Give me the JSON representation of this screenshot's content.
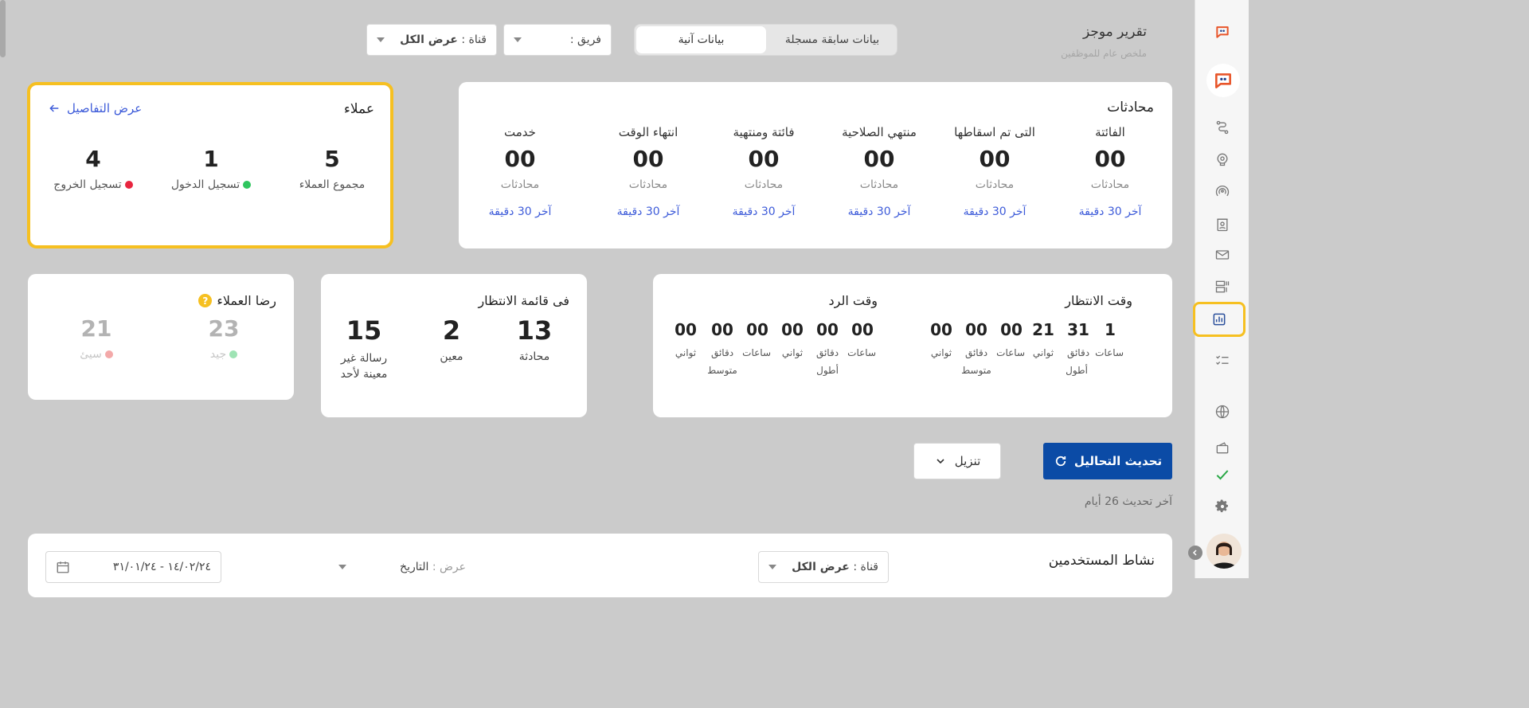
{
  "header": {
    "title": "تقرير موجز",
    "subtitle": "ملخص عام للموظفين",
    "mode_tabs": {
      "active": "بيانات آنية",
      "inactive": "بيانات سابقة مسجلة"
    },
    "team_filter": {
      "label": "فريق :",
      "value": ""
    },
    "channel_filter": {
      "label": "قناة :",
      "value": "عرض الكل"
    }
  },
  "chats_card": {
    "title": "محادثات",
    "columns": [
      {
        "label": "الفائتة",
        "value": "00",
        "unit": "محادثات",
        "link": "آخر 30 دقيقة"
      },
      {
        "label": "التى تم اسقاطها",
        "value": "00",
        "unit": "محادثات",
        "link": "آخر 30 دقيقة"
      },
      {
        "label": "منتهي الصلاحية",
        "value": "00",
        "unit": "محادثات",
        "link": "آخر 30 دقيقة"
      },
      {
        "label": "فائتة ومنتهية",
        "value": "00",
        "unit": "محادثات",
        "link": "آخر 30 دقيقة"
      },
      {
        "label": "انتهاء الوقت",
        "value": "00",
        "unit": "محادثات",
        "link": "آخر 30 دقيقة"
      },
      {
        "label": "خدمت",
        "value": "00",
        "unit": "محادثات",
        "link": "آخر 30 دقيقة"
      }
    ]
  },
  "agents_card": {
    "title": "عملاء",
    "details_link": "عرض التفاصيل",
    "total": {
      "label": "مجموع العملاء",
      "value": "5"
    },
    "logged_in": {
      "label": "تسجيل الدخول",
      "value": "1",
      "color": "#2fc55e"
    },
    "logged_out": {
      "label": "تسجيل الخروج",
      "value": "4",
      "color": "#e8253f"
    }
  },
  "time_card": {
    "wait": {
      "title": "وقت الانتظار",
      "longest_label": "أطول",
      "average_label": "متوسط",
      "longest": {
        "hours": "1",
        "minutes": "31",
        "seconds": "21"
      },
      "average": {
        "hours": "00",
        "minutes": "00",
        "seconds": "00"
      }
    },
    "reply": {
      "title": "وقت الرد",
      "longest_label": "أطول",
      "average_label": "متوسط",
      "longest": {
        "hours": "00",
        "minutes": "00",
        "seconds": "00"
      },
      "average": {
        "hours": "00",
        "minutes": "00",
        "seconds": "00"
      }
    },
    "units": {
      "hours": "ساعات",
      "minutes": "دقائق",
      "seconds": "ثواني"
    }
  },
  "queue_card": {
    "title": "فى قائمة الانتظار",
    "chat": {
      "label": "محادثة",
      "value": "13"
    },
    "assigned": {
      "label": "معين",
      "value": "2"
    },
    "unassigned": {
      "label": "رسالة غير معينة لأحد",
      "value": "15"
    }
  },
  "satisfaction_card": {
    "title": "رضا العملاء",
    "good": {
      "label": "جيد",
      "value": "23",
      "color": "#9ee3b4"
    },
    "bad": {
      "label": "سيئ",
      "value": "21",
      "color": "#f3a9a9"
    }
  },
  "actions": {
    "refresh": "تحديث التحاليل",
    "download": "تنزيل",
    "last_update": "آخر تحديث 26 أيام"
  },
  "user_activity": {
    "title": "نشاط المستخدمين",
    "channel_label": "قناة :",
    "channel_value": "عرض الكل",
    "view_label": "عرض :",
    "view_value": "التاريخ",
    "date_range": "١٤/٠٢/٢٤ - ٣١/٠١/٢٤"
  }
}
